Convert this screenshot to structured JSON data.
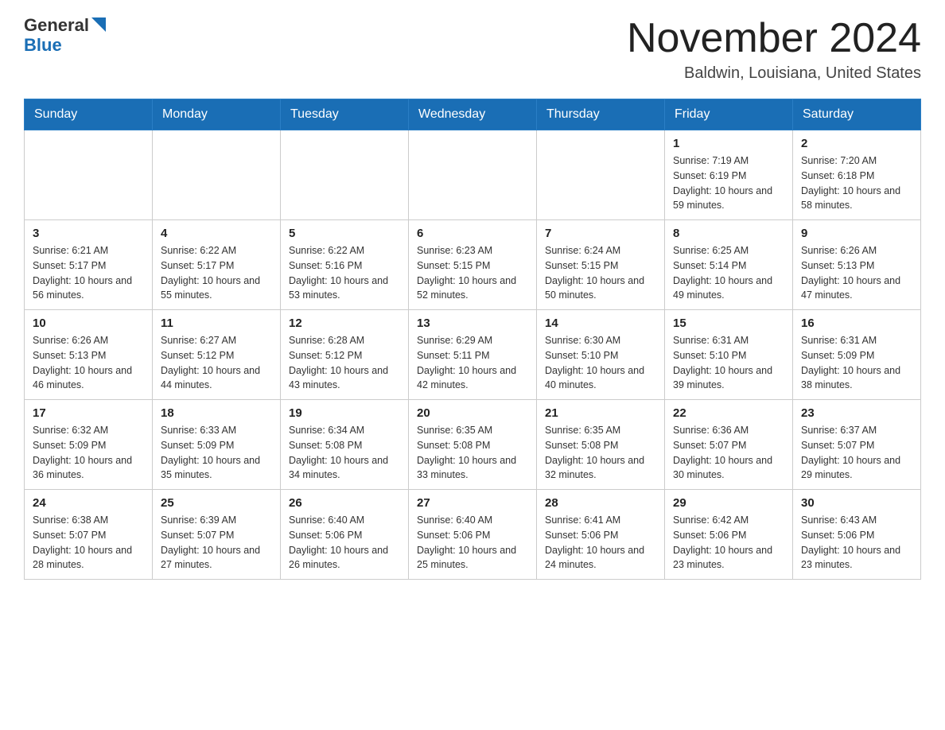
{
  "header": {
    "logo_text_general": "General",
    "logo_text_blue": "Blue",
    "month_title": "November 2024",
    "location": "Baldwin, Louisiana, United States"
  },
  "weekdays": [
    "Sunday",
    "Monday",
    "Tuesday",
    "Wednesday",
    "Thursday",
    "Friday",
    "Saturday"
  ],
  "rows": [
    [
      {
        "day": "",
        "sunrise": "",
        "sunset": "",
        "daylight": ""
      },
      {
        "day": "",
        "sunrise": "",
        "sunset": "",
        "daylight": ""
      },
      {
        "day": "",
        "sunrise": "",
        "sunset": "",
        "daylight": ""
      },
      {
        "day": "",
        "sunrise": "",
        "sunset": "",
        "daylight": ""
      },
      {
        "day": "",
        "sunrise": "",
        "sunset": "",
        "daylight": ""
      },
      {
        "day": "1",
        "sunrise": "Sunrise: 7:19 AM",
        "sunset": "Sunset: 6:19 PM",
        "daylight": "Daylight: 10 hours and 59 minutes."
      },
      {
        "day": "2",
        "sunrise": "Sunrise: 7:20 AM",
        "sunset": "Sunset: 6:18 PM",
        "daylight": "Daylight: 10 hours and 58 minutes."
      }
    ],
    [
      {
        "day": "3",
        "sunrise": "Sunrise: 6:21 AM",
        "sunset": "Sunset: 5:17 PM",
        "daylight": "Daylight: 10 hours and 56 minutes."
      },
      {
        "day": "4",
        "sunrise": "Sunrise: 6:22 AM",
        "sunset": "Sunset: 5:17 PM",
        "daylight": "Daylight: 10 hours and 55 minutes."
      },
      {
        "day": "5",
        "sunrise": "Sunrise: 6:22 AM",
        "sunset": "Sunset: 5:16 PM",
        "daylight": "Daylight: 10 hours and 53 minutes."
      },
      {
        "day": "6",
        "sunrise": "Sunrise: 6:23 AM",
        "sunset": "Sunset: 5:15 PM",
        "daylight": "Daylight: 10 hours and 52 minutes."
      },
      {
        "day": "7",
        "sunrise": "Sunrise: 6:24 AM",
        "sunset": "Sunset: 5:15 PM",
        "daylight": "Daylight: 10 hours and 50 minutes."
      },
      {
        "day": "8",
        "sunrise": "Sunrise: 6:25 AM",
        "sunset": "Sunset: 5:14 PM",
        "daylight": "Daylight: 10 hours and 49 minutes."
      },
      {
        "day": "9",
        "sunrise": "Sunrise: 6:26 AM",
        "sunset": "Sunset: 5:13 PM",
        "daylight": "Daylight: 10 hours and 47 minutes."
      }
    ],
    [
      {
        "day": "10",
        "sunrise": "Sunrise: 6:26 AM",
        "sunset": "Sunset: 5:13 PM",
        "daylight": "Daylight: 10 hours and 46 minutes."
      },
      {
        "day": "11",
        "sunrise": "Sunrise: 6:27 AM",
        "sunset": "Sunset: 5:12 PM",
        "daylight": "Daylight: 10 hours and 44 minutes."
      },
      {
        "day": "12",
        "sunrise": "Sunrise: 6:28 AM",
        "sunset": "Sunset: 5:12 PM",
        "daylight": "Daylight: 10 hours and 43 minutes."
      },
      {
        "day": "13",
        "sunrise": "Sunrise: 6:29 AM",
        "sunset": "Sunset: 5:11 PM",
        "daylight": "Daylight: 10 hours and 42 minutes."
      },
      {
        "day": "14",
        "sunrise": "Sunrise: 6:30 AM",
        "sunset": "Sunset: 5:10 PM",
        "daylight": "Daylight: 10 hours and 40 minutes."
      },
      {
        "day": "15",
        "sunrise": "Sunrise: 6:31 AM",
        "sunset": "Sunset: 5:10 PM",
        "daylight": "Daylight: 10 hours and 39 minutes."
      },
      {
        "day": "16",
        "sunrise": "Sunrise: 6:31 AM",
        "sunset": "Sunset: 5:09 PM",
        "daylight": "Daylight: 10 hours and 38 minutes."
      }
    ],
    [
      {
        "day": "17",
        "sunrise": "Sunrise: 6:32 AM",
        "sunset": "Sunset: 5:09 PM",
        "daylight": "Daylight: 10 hours and 36 minutes."
      },
      {
        "day": "18",
        "sunrise": "Sunrise: 6:33 AM",
        "sunset": "Sunset: 5:09 PM",
        "daylight": "Daylight: 10 hours and 35 minutes."
      },
      {
        "day": "19",
        "sunrise": "Sunrise: 6:34 AM",
        "sunset": "Sunset: 5:08 PM",
        "daylight": "Daylight: 10 hours and 34 minutes."
      },
      {
        "day": "20",
        "sunrise": "Sunrise: 6:35 AM",
        "sunset": "Sunset: 5:08 PM",
        "daylight": "Daylight: 10 hours and 33 minutes."
      },
      {
        "day": "21",
        "sunrise": "Sunrise: 6:35 AM",
        "sunset": "Sunset: 5:08 PM",
        "daylight": "Daylight: 10 hours and 32 minutes."
      },
      {
        "day": "22",
        "sunrise": "Sunrise: 6:36 AM",
        "sunset": "Sunset: 5:07 PM",
        "daylight": "Daylight: 10 hours and 30 minutes."
      },
      {
        "day": "23",
        "sunrise": "Sunrise: 6:37 AM",
        "sunset": "Sunset: 5:07 PM",
        "daylight": "Daylight: 10 hours and 29 minutes."
      }
    ],
    [
      {
        "day": "24",
        "sunrise": "Sunrise: 6:38 AM",
        "sunset": "Sunset: 5:07 PM",
        "daylight": "Daylight: 10 hours and 28 minutes."
      },
      {
        "day": "25",
        "sunrise": "Sunrise: 6:39 AM",
        "sunset": "Sunset: 5:07 PM",
        "daylight": "Daylight: 10 hours and 27 minutes."
      },
      {
        "day": "26",
        "sunrise": "Sunrise: 6:40 AM",
        "sunset": "Sunset: 5:06 PM",
        "daylight": "Daylight: 10 hours and 26 minutes."
      },
      {
        "day": "27",
        "sunrise": "Sunrise: 6:40 AM",
        "sunset": "Sunset: 5:06 PM",
        "daylight": "Daylight: 10 hours and 25 minutes."
      },
      {
        "day": "28",
        "sunrise": "Sunrise: 6:41 AM",
        "sunset": "Sunset: 5:06 PM",
        "daylight": "Daylight: 10 hours and 24 minutes."
      },
      {
        "day": "29",
        "sunrise": "Sunrise: 6:42 AM",
        "sunset": "Sunset: 5:06 PM",
        "daylight": "Daylight: 10 hours and 23 minutes."
      },
      {
        "day": "30",
        "sunrise": "Sunrise: 6:43 AM",
        "sunset": "Sunset: 5:06 PM",
        "daylight": "Daylight: 10 hours and 23 minutes."
      }
    ]
  ]
}
